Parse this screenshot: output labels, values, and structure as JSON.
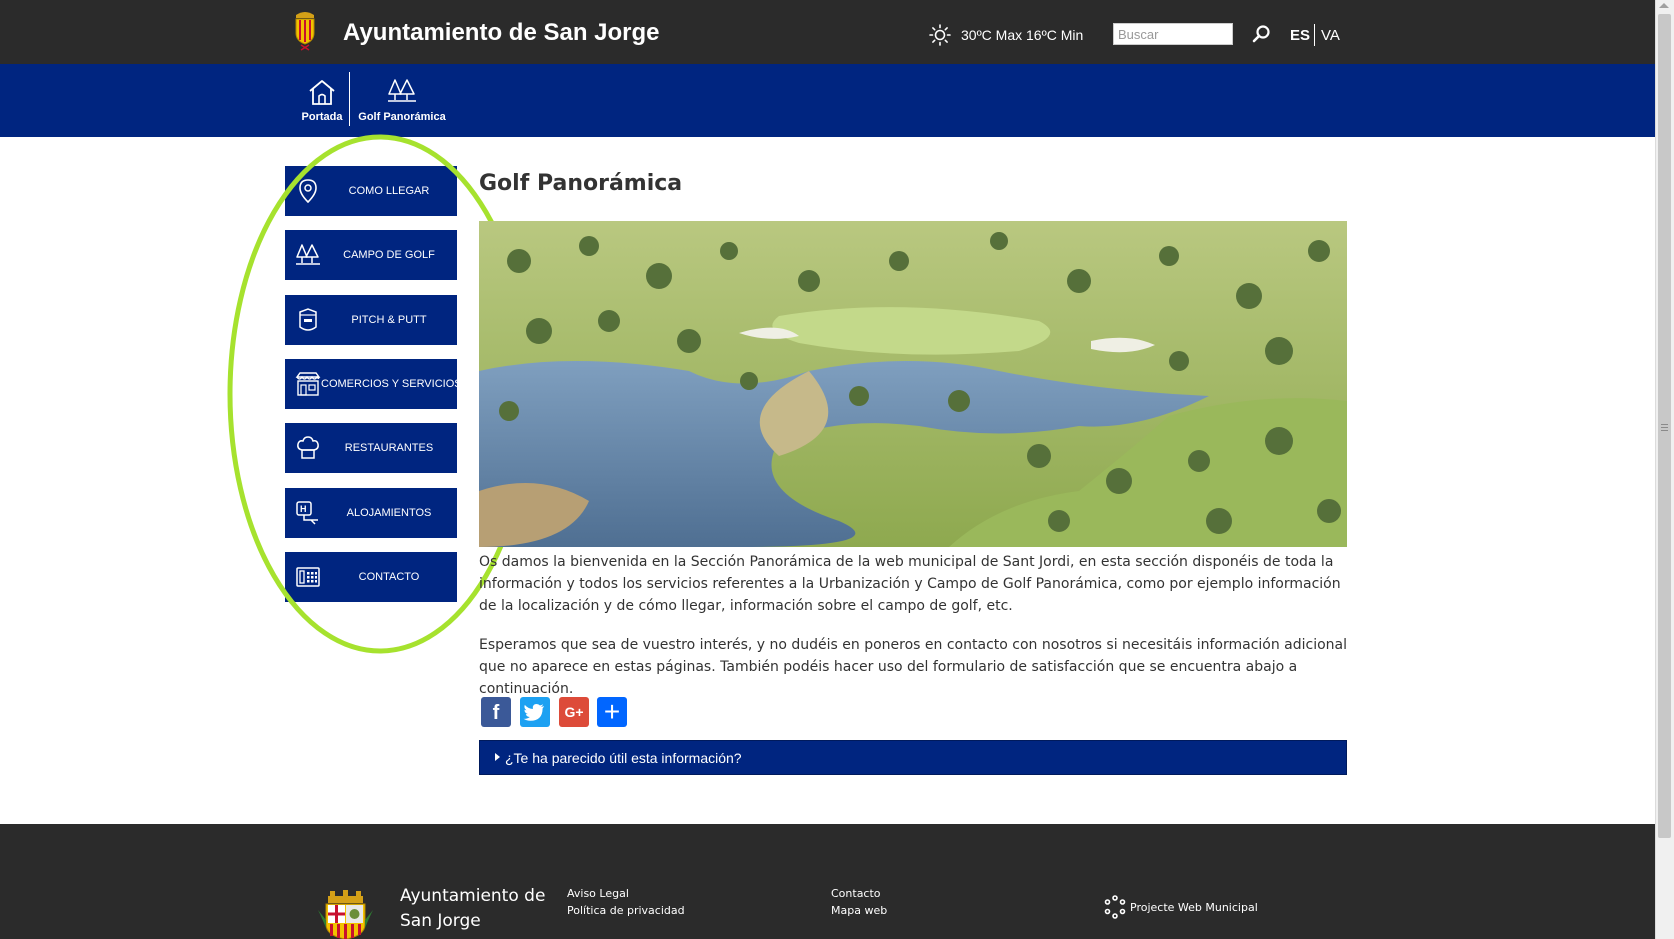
{
  "header": {
    "title": "Ayuntamiento de San Jorge",
    "weather": "30ºC Max 16ºC Min",
    "search_placeholder": "Buscar",
    "lang_es": "ES",
    "lang_va": "VA"
  },
  "nav": {
    "items": [
      {
        "label": "Portada",
        "icon": "home-icon"
      },
      {
        "label": "Golf Panorámica",
        "icon": "trees-icon"
      }
    ]
  },
  "sidebar": {
    "items": [
      {
        "label": "COMO LLEGAR",
        "icon": "map-pin-icon"
      },
      {
        "label": "CAMPO DE GOLF",
        "icon": "trees-icon"
      },
      {
        "label": "PITCH & PUTT",
        "icon": "club-badge-icon"
      },
      {
        "label": "COMERCIOS Y SERVICIOS",
        "icon": "shop-icon"
      },
      {
        "label": "RESTAURANTES",
        "icon": "chef-hat-icon"
      },
      {
        "label": "ALOJAMIENTOS",
        "icon": "hotel-icon"
      },
      {
        "label": "CONTACTO",
        "icon": "phone-book-icon"
      }
    ],
    "highlight_color": "#a6e22e"
  },
  "main": {
    "title": "Golf Panorámica",
    "paragraphs": [
      "Os damos la bienvenida en la Sección Panorámica de la web municipal de Sant Jordi, en esta sección disponéis de toda la información y todos los servicios referentes a la Urbanización y Campo de Golf Panorámica, como por ejemplo información de la localización y de cómo llegar, información sobre el campo de golf, etc.",
      "Esperamos que sea de vuestro interés, y no dudéis en poneros en contacto con nosotros si necesitáis información adicional que no aparece en estas páginas. También podéis hacer uso del formulario de satisfacción que se encuentra abajo a continuación."
    ],
    "share": {
      "facebook": "f",
      "google": "G+",
      "add": "+"
    },
    "feedback": "¿Te ha parecido útil esta información?"
  },
  "footer": {
    "title_line1": "Ayuntamiento de",
    "title_line2": "San Jorge",
    "links_col1": [
      "Aviso Legal",
      "Política de privacidad"
    ],
    "links_col2": [
      "Contacto",
      "Mapa web"
    ],
    "project": "Projecte Web Municipal"
  },
  "colors": {
    "topbar": "#2b2b2b",
    "nav_blue": "#002580",
    "footer": "#2b2b2b"
  }
}
